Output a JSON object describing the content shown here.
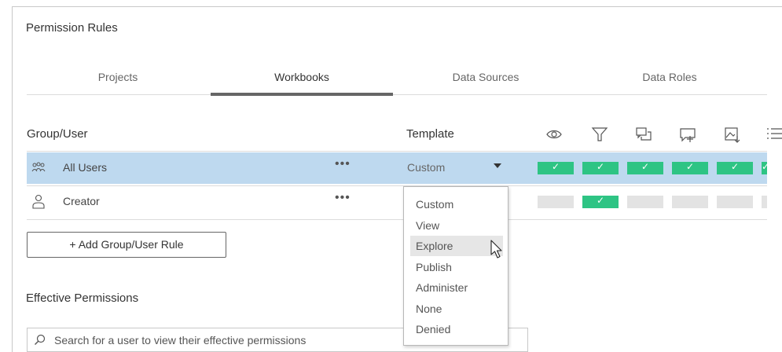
{
  "permission_rules": {
    "title": "Permission Rules"
  },
  "tabs": [
    {
      "label": "Projects",
      "active": false
    },
    {
      "label": "Workbooks",
      "active": true
    },
    {
      "label": "Data Sources",
      "active": false
    },
    {
      "label": "Data Roles",
      "active": false
    }
  ],
  "table": {
    "headers": {
      "group_user": "Group/User",
      "template": "Template"
    },
    "capability_icons": [
      "view-icon",
      "filter-icon",
      "comment-icon",
      "add-comment-icon",
      "download-image-icon",
      "summary-data-icon"
    ],
    "rows": [
      {
        "name": "All Users",
        "icon": "group-icon",
        "more": "•••",
        "template": "Custom",
        "selected": true,
        "capabilities": [
          "allowed",
          "allowed",
          "allowed",
          "allowed",
          "allowed",
          "allowed"
        ]
      },
      {
        "name": "Creator",
        "icon": "user-icon",
        "more": "•••",
        "template": "",
        "capabilities": [
          "unspecified",
          "allowed",
          "unspecified",
          "unspecified",
          "unspecified",
          "unspecified"
        ]
      }
    ]
  },
  "template_dropdown": {
    "options": [
      "Custom",
      "View",
      "Explore",
      "Publish",
      "Administer",
      "None",
      "Denied"
    ],
    "hovered": "Explore"
  },
  "add_rule_button": {
    "label": "+ Add Group/User Rule"
  },
  "effective_permissions": {
    "title": "Effective Permissions",
    "search_placeholder": "Search for a user to view their effective permissions"
  },
  "colors": {
    "selected_row": "#bed9ef",
    "allowed": "#2ec484",
    "unspecified": "#e3e3e3",
    "active_tab_underline": "#666666"
  }
}
